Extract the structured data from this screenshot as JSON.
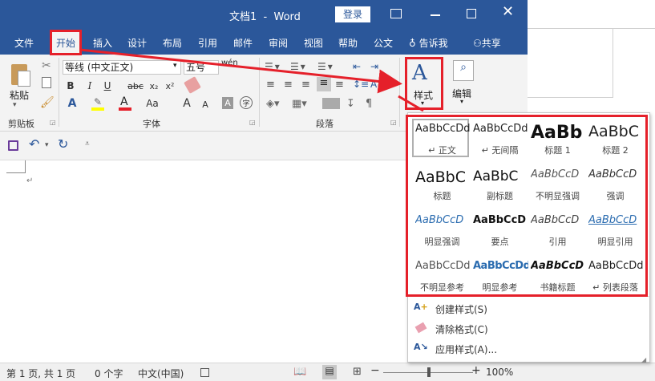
{
  "window": {
    "title": "文档1  -  Word",
    "signin": "登录"
  },
  "tabs": [
    "文件",
    "开始",
    "插入",
    "设计",
    "布局",
    "引用",
    "邮件",
    "审阅",
    "视图",
    "帮助",
    "公文"
  ],
  "tellme": "告诉我",
  "share": "共享",
  "ribbon": {
    "paste": "粘贴",
    "clipboard": "剪贴板",
    "font_name": "等线 (中文正文)",
    "font_size": "五号",
    "wen": "wén",
    "font_group": "字体",
    "paragraph_group": "段落",
    "styles_btn": "样式",
    "editing_btn": "编辑",
    "bold": "B",
    "italic": "I",
    "underline": "U",
    "strike": "abc",
    "sub": "x₂",
    "sup": "x²",
    "aa": "Aa",
    "A_big": "A",
    "A_small": "A"
  },
  "styles": [
    {
      "preview": "AaBbCcDd",
      "name": "↵ 正文"
    },
    {
      "preview": "AaBbCcDd",
      "name": "↵ 无间隔"
    },
    {
      "preview": "AaBb",
      "name": "标题 1"
    },
    {
      "preview": "AaBbC",
      "name": "标题 2"
    },
    {
      "preview": "AaBbC",
      "name": "标题"
    },
    {
      "preview": "AaBbC",
      "name": "副标题"
    },
    {
      "preview": "AaBbCcD",
      "name": "不明显强调"
    },
    {
      "preview": "AaBbCcD",
      "name": "强调"
    },
    {
      "preview": "AaBbCcD",
      "name": "明显强调"
    },
    {
      "preview": "AaBbCcD",
      "name": "要点"
    },
    {
      "preview": "AaBbCcD",
      "name": "引用"
    },
    {
      "preview": "AaBbCcD",
      "name": "明显引用"
    },
    {
      "preview": "AaBbCcDd",
      "name": "不明显参考"
    },
    {
      "preview": "AaBbCcDd",
      "name": "明显参考"
    },
    {
      "preview": "AaBbCcD",
      "name": "书籍标题"
    },
    {
      "preview": "AaBbCcDd",
      "name": "↵ 列表段落"
    }
  ],
  "menu": {
    "create": "创建样式(S)",
    "clear": "清除格式(C)",
    "apply": "应用样式(A)..."
  },
  "status": {
    "page": "第 1 页, 共 1 页",
    "words": "0 个字",
    "lang": "中文(中国)",
    "zoom": "100%"
  },
  "doc": {
    "para_mark": "↵"
  },
  "colors": {
    "accent": "#2b579a",
    "highlight": "#e5202a"
  }
}
